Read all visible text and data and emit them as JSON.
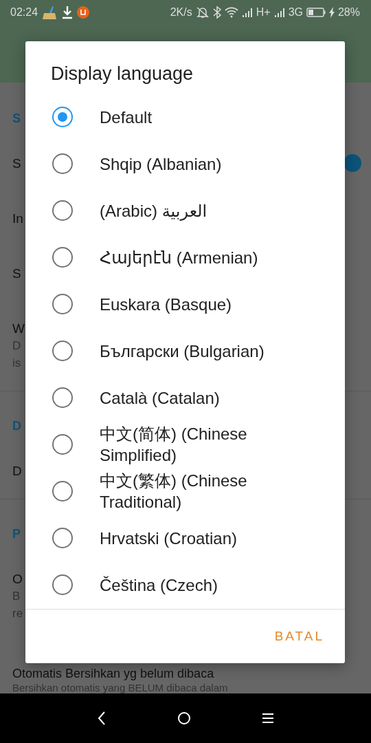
{
  "status_bar": {
    "time": "02:24",
    "speed": "2K/s",
    "network_1": "H+",
    "network_2": "3G",
    "battery": "28%"
  },
  "background_settings": [
    {
      "header": "S",
      "items": [
        {
          "title": "S",
          "toggle": {
            "on": true
          }
        },
        {
          "title": "In"
        },
        {
          "title": "S"
        },
        {
          "title": "W",
          "summary": [
            "D",
            "is"
          ]
        }
      ]
    },
    {
      "header": "D",
      "items": [
        {
          "title": "D"
        }
      ]
    },
    {
      "header": "P",
      "items": [
        {
          "title": "O",
          "summary": [
            "B",
            "re"
          ]
        },
        {
          "title": "Otomatis Bersihkan yg belum dibaca",
          "summary": [
            "Bersihkan otomatis yang BELUM dibaca dalam"
          ]
        }
      ]
    }
  ],
  "dialog": {
    "title": "Display language",
    "options": [
      {
        "label": "Default",
        "selected": true
      },
      {
        "label": "Shqip (Albanian)",
        "selected": false
      },
      {
        "label": "(Arabic) العربية",
        "selected": false
      },
      {
        "label": "Հայերէն (Armenian)",
        "selected": false
      },
      {
        "label": "Euskara (Basque)",
        "selected": false
      },
      {
        "label": "Български (Bulgarian)",
        "selected": false
      },
      {
        "label": "Català (Catalan)",
        "selected": false
      },
      {
        "label": "中文(简体) (Chinese Simplified)",
        "selected": false
      },
      {
        "label": "中文(繁体) (Chinese Traditional)",
        "selected": false
      },
      {
        "label": "Hrvatski (Croatian)",
        "selected": false
      },
      {
        "label": "Čeština (Czech)",
        "selected": false
      }
    ],
    "cancel_button": "BATAL"
  }
}
